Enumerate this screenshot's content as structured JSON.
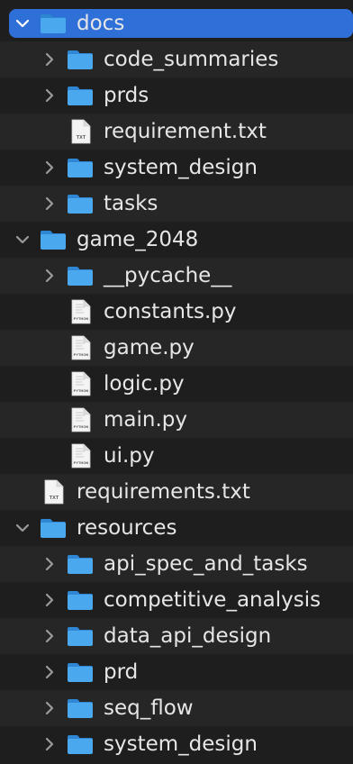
{
  "tree": [
    {
      "label": "docs",
      "kind": "folder",
      "level": 0,
      "expanded": true,
      "selected": true,
      "icon": "folder-icon"
    },
    {
      "label": "code_summaries",
      "kind": "folder",
      "level": 1,
      "expanded": false,
      "icon": "folder-icon"
    },
    {
      "label": "prds",
      "kind": "folder",
      "level": 1,
      "expanded": false,
      "icon": "folder-icon"
    },
    {
      "label": "requirement.txt",
      "kind": "file",
      "level": 1,
      "badge": "TXT",
      "icon": "text-file-icon"
    },
    {
      "label": "system_design",
      "kind": "folder",
      "level": 1,
      "expanded": false,
      "icon": "folder-icon"
    },
    {
      "label": "tasks",
      "kind": "folder",
      "level": 1,
      "expanded": false,
      "icon": "folder-icon"
    },
    {
      "label": "game_2048",
      "kind": "folder",
      "level": 0,
      "expanded": true,
      "icon": "folder-icon"
    },
    {
      "label": "__pycache__",
      "kind": "folder",
      "level": 1,
      "expanded": false,
      "icon": "folder-icon"
    },
    {
      "label": "constants.py",
      "kind": "file",
      "level": 1,
      "badge": "PYTHON",
      "icon": "python-file-icon"
    },
    {
      "label": "game.py",
      "kind": "file",
      "level": 1,
      "badge": "PYTHON",
      "icon": "python-file-icon"
    },
    {
      "label": "logic.py",
      "kind": "file",
      "level": 1,
      "badge": "PYTHON",
      "icon": "python-file-icon"
    },
    {
      "label": "main.py",
      "kind": "file",
      "level": 1,
      "badge": "PYTHON",
      "icon": "python-file-icon"
    },
    {
      "label": "ui.py",
      "kind": "file",
      "level": 1,
      "badge": "PYTHON",
      "icon": "python-file-icon"
    },
    {
      "label": "requirements.txt",
      "kind": "file",
      "level": 0,
      "badge": "TXT",
      "icon": "text-file-icon"
    },
    {
      "label": "resources",
      "kind": "folder",
      "level": 0,
      "expanded": true,
      "icon": "folder-icon"
    },
    {
      "label": "api_spec_and_tasks",
      "kind": "folder",
      "level": 1,
      "expanded": false,
      "icon": "folder-icon"
    },
    {
      "label": "competitive_analysis",
      "kind": "folder",
      "level": 1,
      "expanded": false,
      "icon": "folder-icon"
    },
    {
      "label": "data_api_design",
      "kind": "folder",
      "level": 1,
      "expanded": false,
      "icon": "folder-icon"
    },
    {
      "label": "prd",
      "kind": "folder",
      "level": 1,
      "expanded": false,
      "icon": "folder-icon"
    },
    {
      "label": "seq_flow",
      "kind": "folder",
      "level": 1,
      "expanded": false,
      "icon": "folder-icon"
    },
    {
      "label": "system_design",
      "kind": "folder",
      "level": 1,
      "expanded": false,
      "icon": "folder-icon"
    }
  ],
  "colors": {
    "background": "#1e1e1e",
    "row_alt": "#262626",
    "selection": "#2f6fd8",
    "folder": "#4aa8ee",
    "folder_tab": "#2f86d3",
    "text": "#e6e6e6",
    "chevron": "#9a9a9a"
  }
}
